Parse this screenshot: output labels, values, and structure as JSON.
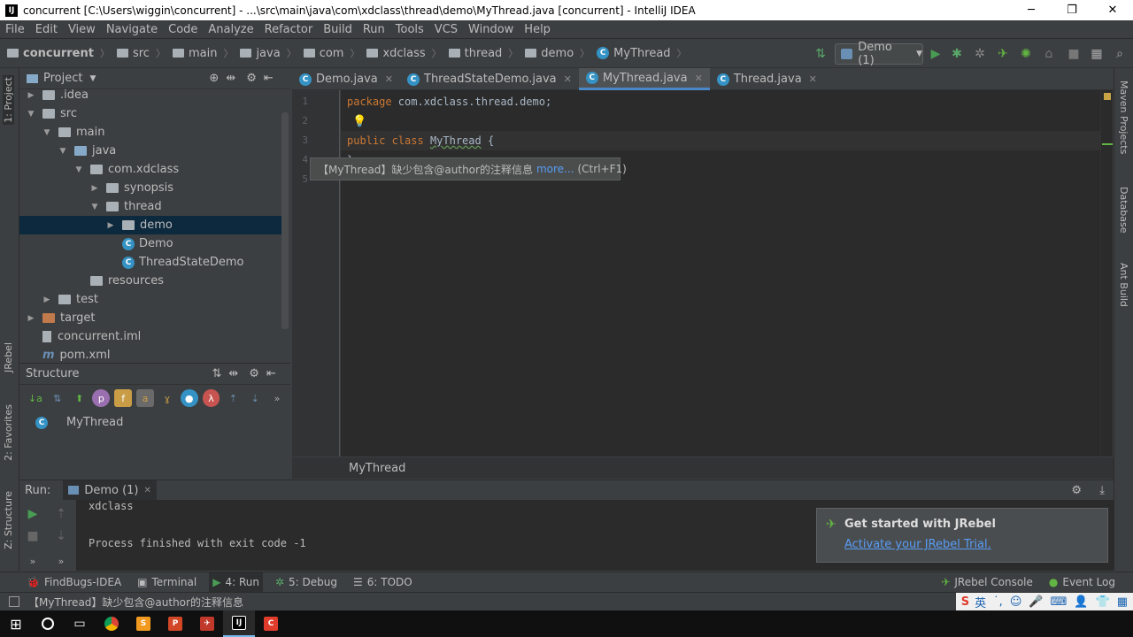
{
  "window": {
    "title": "concurrent [C:\\Users\\wiggin\\concurrent] - ...\\src\\main\\java\\com\\xdclass\\thread\\demo\\MyThread.java [concurrent] - IntelliJ IDEA",
    "minimize": "─",
    "maximize": "❐",
    "close": "✕"
  },
  "menu": [
    "File",
    "Edit",
    "View",
    "Navigate",
    "Code",
    "Analyze",
    "Refactor",
    "Build",
    "Run",
    "Tools",
    "VCS",
    "Window",
    "Help"
  ],
  "breadcrumbs": [
    "concurrent",
    "src",
    "main",
    "java",
    "com",
    "xdclass",
    "thread",
    "demo",
    "MyThread"
  ],
  "run_config": "Demo (1)",
  "left_strip": {
    "project": "1: Project",
    "jrebel": "JRebel",
    "favorites": "2: Favorites",
    "structure": "Z: Structure"
  },
  "right_strip": {
    "maven": "Maven Projects",
    "database": "Database",
    "ant": "Ant Build"
  },
  "project_panel": {
    "header": "Project",
    "tree": [
      {
        "label": ".idea",
        "depth": 1,
        "kind": "folder",
        "arrow": "▶"
      },
      {
        "label": "src",
        "depth": 1,
        "kind": "folder",
        "arrow": "▼"
      },
      {
        "label": "main",
        "depth": 2,
        "kind": "folder",
        "arrow": "▼"
      },
      {
        "label": "java",
        "depth": 3,
        "kind": "folder-blue",
        "arrow": "▼"
      },
      {
        "label": "com.xdclass",
        "depth": 4,
        "kind": "package",
        "arrow": "▼"
      },
      {
        "label": "synopsis",
        "depth": 5,
        "kind": "package",
        "arrow": "▶"
      },
      {
        "label": "thread",
        "depth": 5,
        "kind": "package",
        "arrow": "▼"
      },
      {
        "label": "demo",
        "depth": 6,
        "kind": "package",
        "arrow": "▶",
        "selected": true
      },
      {
        "label": "Demo",
        "depth": 6,
        "kind": "class",
        "arrow": ""
      },
      {
        "label": "ThreadStateDemo",
        "depth": 6,
        "kind": "class",
        "arrow": ""
      },
      {
        "label": "resources",
        "depth": 4,
        "kind": "res",
        "arrow": ""
      },
      {
        "label": "test",
        "depth": 2,
        "kind": "folder",
        "arrow": "▶"
      },
      {
        "label": "target",
        "depth": 1,
        "kind": "folder-orange",
        "arrow": "▶"
      },
      {
        "label": "concurrent.iml",
        "depth": 1,
        "kind": "file",
        "arrow": ""
      },
      {
        "label": "pom.xml",
        "depth": 1,
        "kind": "maven",
        "arrow": ""
      }
    ]
  },
  "structure_panel": {
    "header": "Structure",
    "item": "MyThread",
    "more": "»"
  },
  "editor_tabs": [
    {
      "label": "Demo.java",
      "active": false
    },
    {
      "label": "ThreadStateDemo.java",
      "active": false
    },
    {
      "label": "MyThread.java",
      "active": true
    },
    {
      "label": "Thread.java",
      "active": false
    }
  ],
  "code": {
    "line_numbers": [
      "1",
      "2",
      "3",
      "4",
      "5"
    ],
    "line1_kw": "package",
    "line1_rest": " com.xdclass.thread.demo;",
    "line3_kw": "public class",
    "line3_name": "MyThread",
    "line3_brace": " {",
    "line4": "}"
  },
  "tooltip": {
    "text": "【MyThread】缺少包含@author的注释信息",
    "link": "more...",
    "shortcut": "(Ctrl+F1)"
  },
  "editor_footer": "MyThread",
  "run_panel": {
    "label": "Run:",
    "tab": "Demo (1)",
    "output_line1": "xdclass",
    "output_line2": "Process finished with exit code -1",
    "more": "»"
  },
  "notification": {
    "title": "Get started with JRebel",
    "link": "Activate your JRebel Trial."
  },
  "tool_windows": [
    {
      "label": "FindBugs-IDEA",
      "icon": "🐞"
    },
    {
      "label": "Terminal",
      "icon": "▣"
    },
    {
      "label": "4: Run",
      "icon": "▶",
      "active": true
    },
    {
      "label": "5: Debug",
      "icon": "✲"
    },
    {
      "label": "6: TODO",
      "icon": "☰"
    }
  ],
  "tool_windows_right": [
    {
      "label": "JRebel Console"
    },
    {
      "label": "Event Log"
    }
  ],
  "status_text": "【MyThread】缺少包含@author的注释信息",
  "ime": {
    "lang": "英"
  }
}
